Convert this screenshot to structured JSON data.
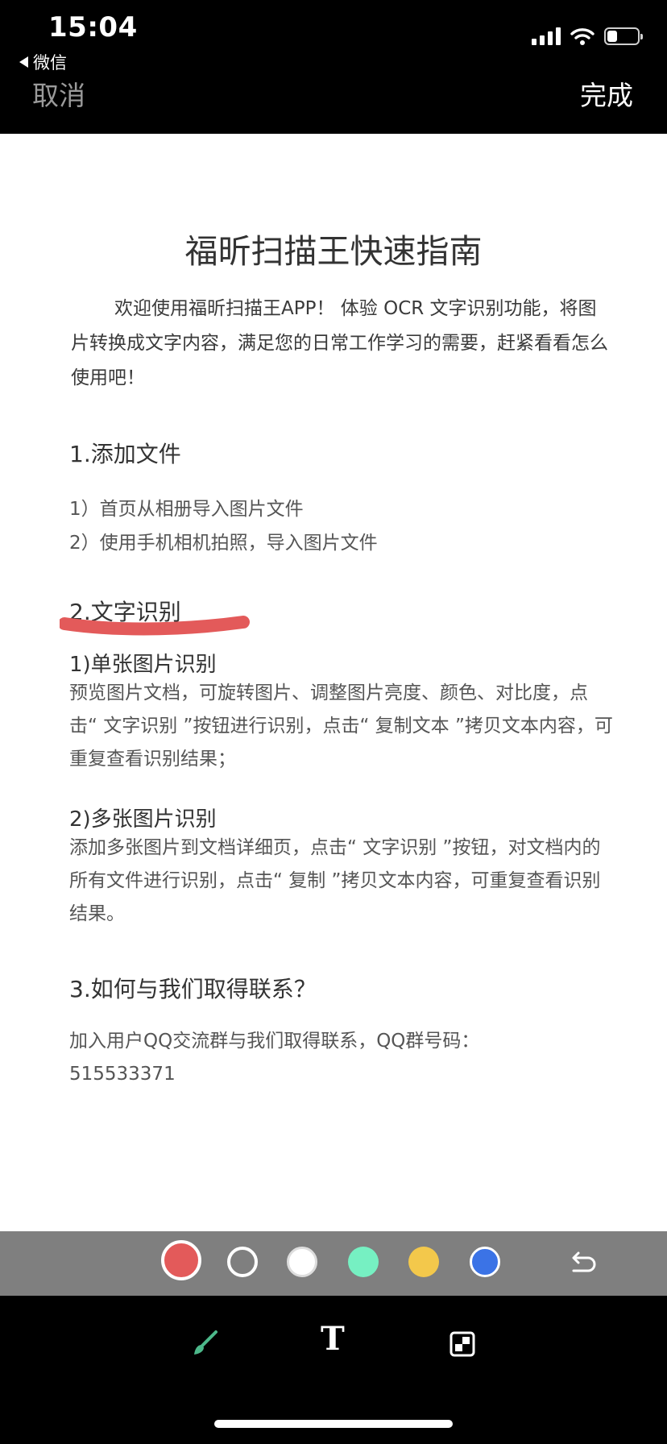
{
  "status_bar": {
    "time": "15:04",
    "back_app": "微信",
    "icons": [
      "signal-icon",
      "wifi-icon",
      "battery-icon"
    ]
  },
  "nav": {
    "cancel_label": "取消",
    "done_label": "完成"
  },
  "document": {
    "title": "福昕扫描王快速指南",
    "intro": "欢迎使用福昕扫描王APP！ 体验 OCR 文字识别功能，将图片转换成文字内容，满足您的日常工作学习的需要，赶紧看看怎么使用吧！",
    "section1": {
      "heading": "1.添加文件",
      "items": [
        "1）首页从相册导入图片文件",
        "2）使用手机相机拍照，导入图片文件"
      ]
    },
    "section2": {
      "heading": "2.文字识别",
      "sub1_heading": "1)单张图片识别",
      "sub1_text": "预览图片文档，可旋转图片、调整图片亮度、颜色、对比度，点击“ 文字识别 ”按钮进行识别，点击“ 复制文本 ”拷贝文本内容，可重复查看识别结果；",
      "sub2_heading": "2)多张图片识别",
      "sub2_text": "添加多张图片到文档详细页，点击“ 文字识别 ”按钮，对文档内的所有文件进行识别，点击“ 复制 ”拷贝文本内容，可重复查看识别结果。"
    },
    "section3": {
      "heading": "3.如何与我们取得联系？",
      "contact_text": "加入用户QQ交流群与我们取得联系，QQ群号码：",
      "contact_number": "515533371"
    }
  },
  "annotation": {
    "stroke_color": "#e35a5a"
  },
  "palette": {
    "colors": [
      {
        "name": "red",
        "hex": "#e35a5a",
        "selected": true
      },
      {
        "name": "black",
        "hex": "#000000",
        "selected": false
      },
      {
        "name": "white",
        "hex": "#ffffff",
        "selected": false
      },
      {
        "name": "mint",
        "hex": "#76f0c2",
        "selected": false
      },
      {
        "name": "yellow",
        "hex": "#f3c84b",
        "selected": false
      },
      {
        "name": "blue",
        "hex": "#3b73e6",
        "selected": false
      }
    ],
    "undo_icon": "undo-icon"
  },
  "tools": {
    "pen_icon": "brush-icon",
    "text_label": "T",
    "mosaic_icon": "mosaic-icon"
  }
}
